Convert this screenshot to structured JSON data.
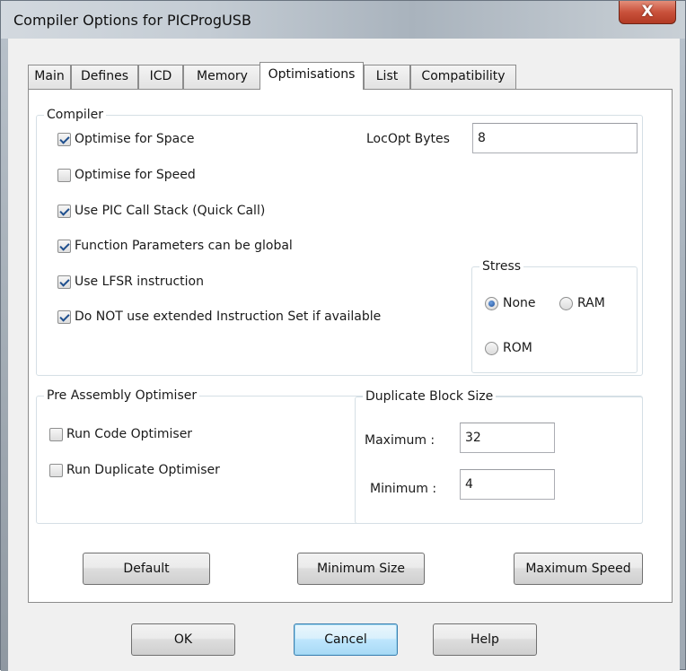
{
  "window": {
    "title": "Compiler Options for PICProgUSB",
    "close_glyph": "X"
  },
  "tabs": [
    {
      "label": "Main"
    },
    {
      "label": "Defines"
    },
    {
      "label": "ICD"
    },
    {
      "label": "Memory"
    },
    {
      "label": "Optimisations"
    },
    {
      "label": "List"
    },
    {
      "label": "Compatibility"
    }
  ],
  "active_tab": "Optimisations",
  "compiler": {
    "group_label": "Compiler",
    "options": [
      {
        "label": "Optimise for Space",
        "checked": true
      },
      {
        "label": "Optimise for Speed",
        "checked": false
      },
      {
        "label": "Use PIC Call Stack (Quick Call)",
        "checked": true
      },
      {
        "label": "Function Parameters can be global",
        "checked": true
      },
      {
        "label": "Use LFSR instruction",
        "checked": true
      },
      {
        "label": "Do NOT use extended Instruction Set if available",
        "checked": true
      }
    ],
    "locopt_label": "LocOpt Bytes",
    "locopt_value": "8",
    "stress": {
      "group_label": "Stress",
      "options": [
        {
          "label": "None",
          "selected": true
        },
        {
          "label": "RAM",
          "selected": false
        },
        {
          "label": "ROM",
          "selected": false
        }
      ]
    }
  },
  "pre_assembly": {
    "group_label": "Pre Assembly Optimiser",
    "options": [
      {
        "label": "Run Code Optimiser",
        "checked": false
      },
      {
        "label": "Run Duplicate Optimiser",
        "checked": false
      }
    ]
  },
  "duplicate_block": {
    "group_label": "Duplicate Block Size",
    "maximum_label": "Maximum :",
    "maximum_value": "32",
    "minimum_label": "Minimum  :",
    "minimum_value": "4"
  },
  "preset_buttons": {
    "default": "Default",
    "minimum_size": "Minimum Size",
    "maximum_speed": "Maximum Speed"
  },
  "dialog_buttons": {
    "ok": "OK",
    "cancel": "Cancel",
    "help": "Help"
  },
  "colors": {
    "close_button": "#c9513b",
    "check_mark": "#1f4f8e",
    "focus_border": "#3c7fb1"
  }
}
